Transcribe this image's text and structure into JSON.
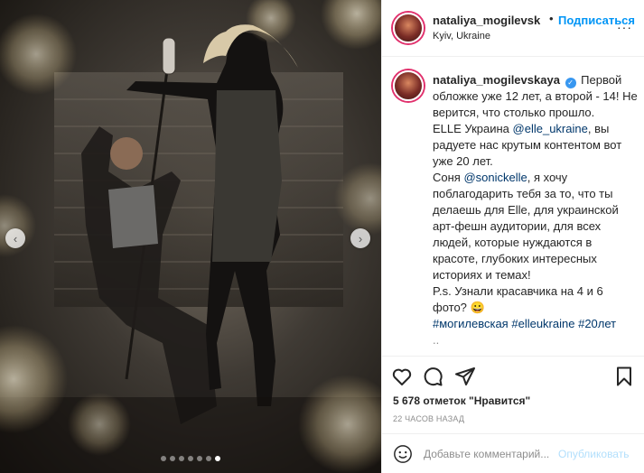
{
  "post": {
    "username": "nataliya_mogilevsk",
    "separator": "•",
    "follow_label": "Подписаться",
    "location": "Kyiv, Ukraine",
    "more_label": "···"
  },
  "caption": {
    "username": "nataliya_mogilevskaya",
    "verified_icon": "✓",
    "line1": "Первой обложке уже 12 лет, а второй - 14! Не верится, что столько прошло.",
    "p2_start": "ELLE Украина ",
    "p2_mention": "@elle_ukraine",
    "p2_end": ", вы радуете нас крутым контентом вот уже 20 лет.",
    "p3_start": "Соня ",
    "p3_mention": "@sonickelle",
    "p3_end": ", я хочу поблагодарить тебя за то, что ты делаешь для Elle, для украинской арт-фешн аудитории, для всех людей, которые нуждаются в красоте, глубоких интересных историях и темах!",
    "p4": "P.s. Узнали красавчика на 4 и 6 фото? 😀",
    "hashtags": [
      "#могилевская",
      "#elleukraine",
      "#20лет"
    ],
    "truncated": ".."
  },
  "actions": {
    "icons": [
      "heart-icon",
      "comment-icon",
      "share-icon",
      "bookmark-icon"
    ],
    "likes": "5 678 отметок \"Нравится\"",
    "timestamp": "22 ЧАСОВ НАЗАД"
  },
  "comment_bar": {
    "placeholder": "Добавьте комментарий...",
    "publish_label": "Опубликовать",
    "emoji_icon": "smiley-icon"
  },
  "carousel": {
    "slide_count": 7,
    "active_index": 6,
    "prev_label": "‹",
    "next_label": "›"
  },
  "colors": {
    "accent": "#0095f6",
    "link": "#00376b",
    "text": "#262626",
    "muted": "#8e8e8e",
    "publish_disabled": "#b2dffc"
  }
}
